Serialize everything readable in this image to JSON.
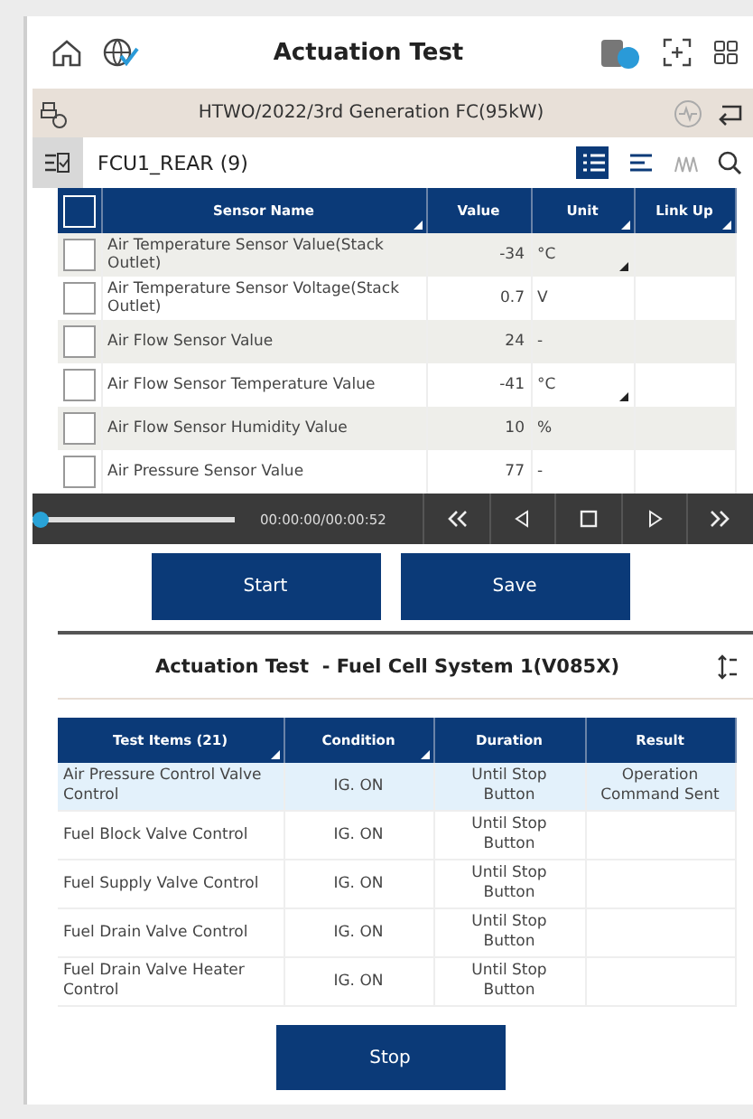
{
  "toolbar": {
    "title": "Actuation Test"
  },
  "vehicle_bar": {
    "text": "HTWO/2022/3rd Generation FC(95kW)"
  },
  "sensor_panel": {
    "group": "FCU1_REAR (9)",
    "view_modes": [
      {
        "kind": "list",
        "selected": true
      },
      {
        "kind": "text",
        "selected": false
      },
      {
        "kind": "graph",
        "selected": false
      }
    ],
    "columns": [
      {
        "label": "Sensor Name",
        "sort_mark": true
      },
      {
        "label": "Value",
        "sort_mark": false
      },
      {
        "label": "Unit",
        "sort_mark": true
      },
      {
        "label": "Link Up",
        "sort_mark": true
      }
    ],
    "header_checked": false,
    "rows": [
      {
        "name": "Air Temperature Sensor Value(Stack Outlet)",
        "value": "-34",
        "unit": "°C",
        "checked": false,
        "flag": true
      },
      {
        "name": "Air Temperature Sensor Voltage(Stack Outlet)",
        "value": "0.7",
        "unit": "V",
        "checked": false,
        "flag": false
      },
      {
        "name": "Air Flow Sensor Value",
        "value": "24",
        "unit": "-",
        "checked": false,
        "flag": false
      },
      {
        "name": "Air Flow Sensor Temperature Value",
        "value": "-41",
        "unit": "°C",
        "checked": false,
        "flag": true
      },
      {
        "name": "Air Flow Sensor Humidity Value",
        "value": "10",
        "unit": "%",
        "checked": false,
        "flag": false
      },
      {
        "name": "Air Pressure Sensor Value",
        "value": "77",
        "unit": "-",
        "checked": false,
        "flag": false
      }
    ]
  },
  "player": {
    "level": 0,
    "time": "00:00:00/00:00:52"
  },
  "buttons": [
    "Start",
    "Save"
  ],
  "test_panel": {
    "title": "Actuation Test  - Fuel Cell System 1(V085X)",
    "columns": [
      {
        "label": "Test Items (21)",
        "sort_mark": true
      },
      {
        "label": "Condition",
        "sort_mark": true
      },
      {
        "label": "Duration",
        "sort_mark": false
      },
      {
        "label": "Result",
        "sort_mark": false
      }
    ],
    "rows": [
      {
        "item": "Air Pressure Control Valve Control",
        "condition": "IG. ON",
        "duration": "Until Stop Button",
        "result": "Operation Command Sent",
        "selected": true
      },
      {
        "item": "Fuel Block Valve Control",
        "condition": "IG. ON",
        "duration": "Until Stop Button",
        "selected": false
      },
      {
        "item": "Fuel Supply Valve Control",
        "condition": "IG. ON",
        "duration": "Until Stop Button",
        "selected": false
      },
      {
        "item": "Fuel Drain Valve Control",
        "condition": "IG. ON",
        "duration": "Until Stop Button",
        "selected": false
      },
      {
        "item": "Fuel Drain Valve Heater Control",
        "condition": "IG. ON",
        "duration": "Until Stop Button",
        "selected": false
      }
    ]
  },
  "stop_button": "Stop"
}
